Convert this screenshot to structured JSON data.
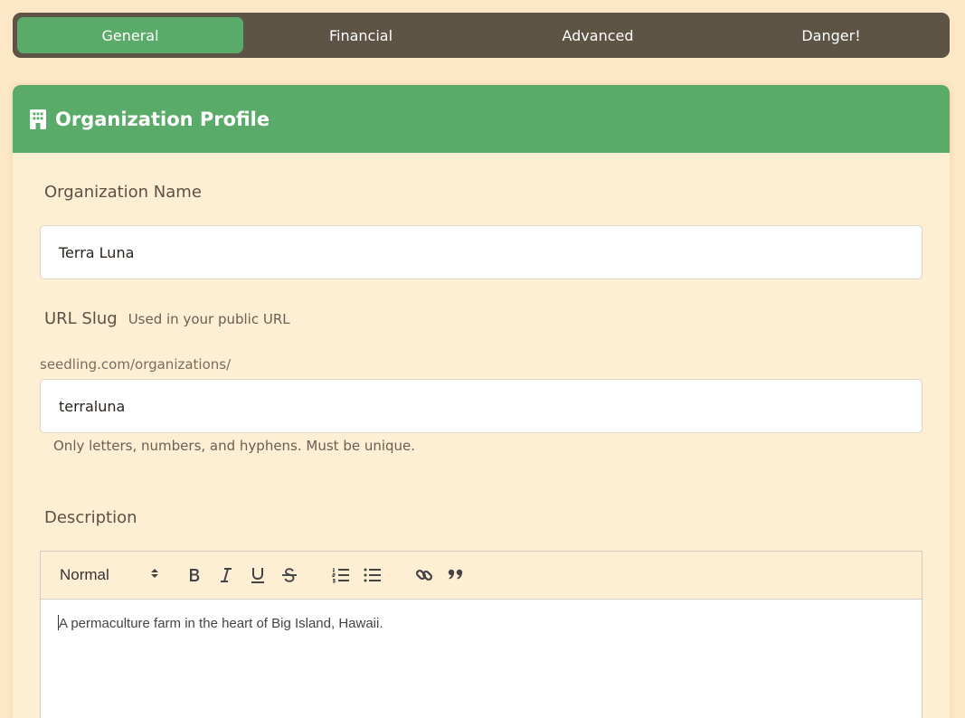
{
  "tabs": [
    {
      "label": "General",
      "active": true
    },
    {
      "label": "Financial",
      "active": false
    },
    {
      "label": "Advanced",
      "active": false
    },
    {
      "label": "Danger!",
      "active": false
    }
  ],
  "card": {
    "title": "Organization Profile",
    "icon": "building-icon"
  },
  "org_name": {
    "label": "Organization Name",
    "value": "Terra Luna"
  },
  "slug": {
    "label": "URL Slug",
    "hint": "Used in your public URL",
    "prefix": "seedling.com/organizations/",
    "value": "terraluna",
    "help": "Only letters, numbers, and hyphens. Must be unique."
  },
  "description": {
    "label": "Description",
    "format": "Normal",
    "content": "A permaculture farm in the heart of Big Island, Hawaii."
  },
  "colors": {
    "accent": "#5aaa6a",
    "tab_bar": "#5e5446",
    "background": "#fde7c6"
  }
}
